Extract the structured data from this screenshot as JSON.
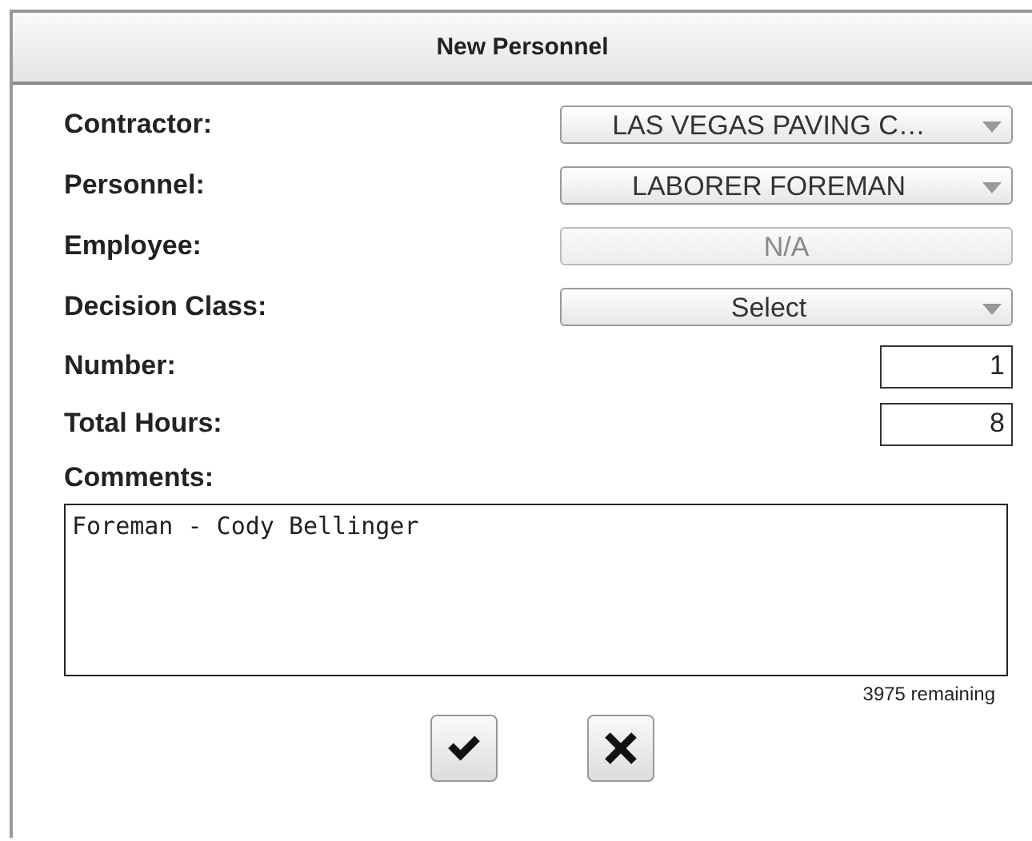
{
  "dialog": {
    "title": "New Personnel"
  },
  "fields": [
    {
      "label": "Contractor:",
      "kind": "select",
      "value": "LAS VEGAS PAVING C…",
      "disabled": false
    },
    {
      "label": "Personnel:",
      "kind": "select",
      "value": "LABORER FOREMAN",
      "disabled": false
    },
    {
      "label": "Employee:",
      "kind": "select",
      "value": "N/A",
      "disabled": true
    },
    {
      "label": "Decision Class:",
      "kind": "select",
      "value": "Select",
      "disabled": false
    },
    {
      "label": "Number:",
      "kind": "number",
      "value": "1"
    },
    {
      "label": "Total Hours:",
      "kind": "number",
      "value": "8"
    }
  ],
  "comments": {
    "label": "Comments:",
    "value": "Foreman - Cody Bellinger",
    "remaining": "3975 remaining"
  },
  "buttons": [
    {
      "kind": "ok"
    },
    {
      "kind": "cancel"
    }
  ]
}
